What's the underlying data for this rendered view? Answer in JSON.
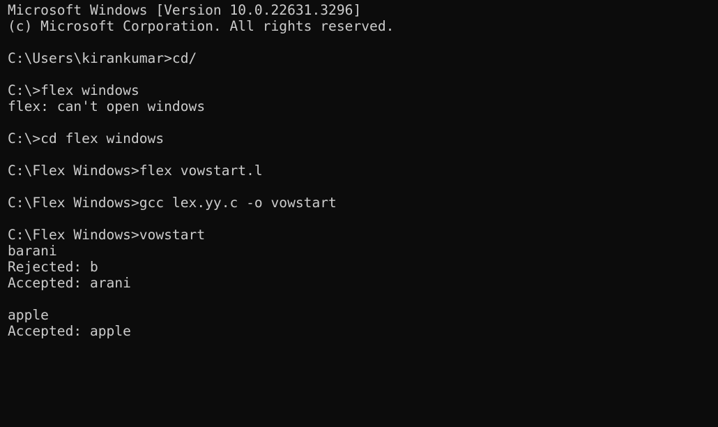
{
  "terminal": {
    "lines": [
      "Microsoft Windows [Version 10.0.22631.3296]",
      "(c) Microsoft Corporation. All rights reserved.",
      "",
      "C:\\Users\\kirankumar>cd/",
      "",
      "C:\\>flex windows",
      "flex: can't open windows",
      "",
      "C:\\>cd flex windows",
      "",
      "C:\\Flex Windows>flex vowstart.l",
      "",
      "C:\\Flex Windows>gcc lex.yy.c -o vowstart",
      "",
      "C:\\Flex Windows>vowstart",
      "barani",
      "Rejected: b",
      "Accepted: arani",
      "",
      "apple",
      "Accepted: apple"
    ]
  },
  "colors": {
    "background": "#0c0c0c",
    "foreground": "#cccccc"
  }
}
